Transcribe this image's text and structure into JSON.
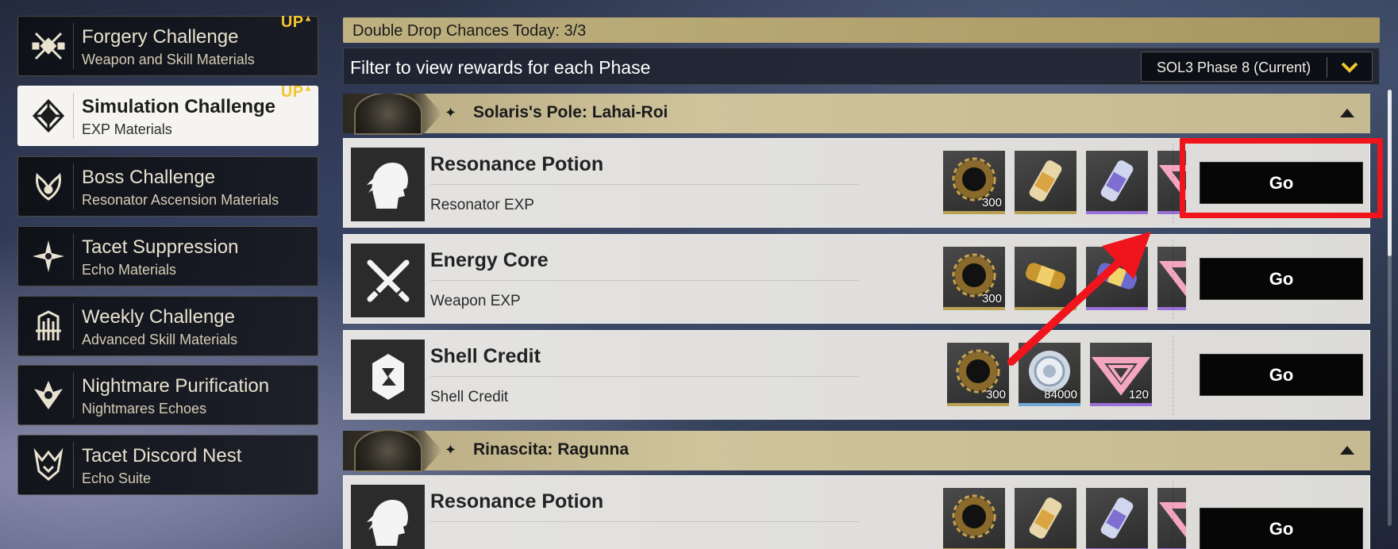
{
  "colors": {
    "accent_gold": "#bfb180",
    "up_badge": "#f2c531",
    "highlight_red": "#f0141c",
    "go_button": "#060606"
  },
  "sidebar": {
    "items": [
      {
        "title": "Forgery Challenge",
        "subtitle": "Weapon and Skill Materials",
        "badge": "UP",
        "icon": "forgery-icon",
        "active": false
      },
      {
        "title": "Simulation Challenge",
        "subtitle": "EXP Materials",
        "badge": "UP",
        "icon": "simulation-icon",
        "active": true
      },
      {
        "title": "Boss Challenge",
        "subtitle": "Resonator Ascension Materials",
        "badge": "",
        "icon": "boss-icon",
        "active": false
      },
      {
        "title": "Tacet Suppression",
        "subtitle": "Echo Materials",
        "badge": "",
        "icon": "tacet-suppression-icon",
        "active": false
      },
      {
        "title": "Weekly Challenge",
        "subtitle": "Advanced Skill Materials",
        "badge": "",
        "icon": "weekly-challenge-icon",
        "active": false
      },
      {
        "title": "Nightmare Purification",
        "subtitle": "Nightmares Echoes",
        "badge": "",
        "icon": "nightmare-icon",
        "active": false
      },
      {
        "title": "Tacet Discord Nest",
        "subtitle": "Echo Suite",
        "badge": "",
        "icon": "tacet-discord-icon",
        "active": false
      }
    ]
  },
  "main": {
    "double_drop": "Double Drop Chances Today: 3/3",
    "filter_text": "Filter to view rewards for each Phase",
    "phase_select": "SOL3 Phase 8 (Current)",
    "sections": [
      {
        "title": "Solaris's Pole: Lahai-Roi",
        "rows": [
          {
            "title": "Resonance Potion",
            "subtitle": "Resonator EXP",
            "icon": "resonator-head-icon",
            "button": "Go",
            "items": [
              {
                "name": "shell-gear",
                "count": "300"
              },
              {
                "name": "basic-potion",
                "count": ""
              },
              {
                "name": "medium-potion",
                "count": ""
              },
              {
                "name": "pink-emblem",
                "count": ""
              }
            ]
          },
          {
            "title": "Energy Core",
            "subtitle": "Weapon EXP",
            "icon": "crossed-swords-icon",
            "button": "Go",
            "items": [
              {
                "name": "shell-gear",
                "count": "300"
              },
              {
                "name": "basic-core",
                "count": ""
              },
              {
                "name": "medium-core",
                "count": ""
              },
              {
                "name": "pink-emblem",
                "count": ""
              }
            ]
          },
          {
            "title": "Shell Credit",
            "subtitle": "Shell Credit",
            "icon": "shell-credit-icon",
            "button": "Go",
            "items": [
              {
                "name": "shell-gear",
                "count": "300"
              },
              {
                "name": "shell-credit-coin",
                "count": "84000"
              },
              {
                "name": "pink-emblem",
                "count": "120"
              }
            ]
          }
        ]
      },
      {
        "title": "Rinascita: Ragunna",
        "rows": [
          {
            "title": "Resonance Potion",
            "subtitle": "",
            "icon": "resonator-head-icon",
            "button": "Go",
            "items": [
              {
                "name": "shell-gear",
                "count": ""
              },
              {
                "name": "basic-potion",
                "count": ""
              },
              {
                "name": "medium-potion",
                "count": ""
              },
              {
                "name": "pink-emblem",
                "count": ""
              }
            ]
          }
        ]
      }
    ]
  }
}
